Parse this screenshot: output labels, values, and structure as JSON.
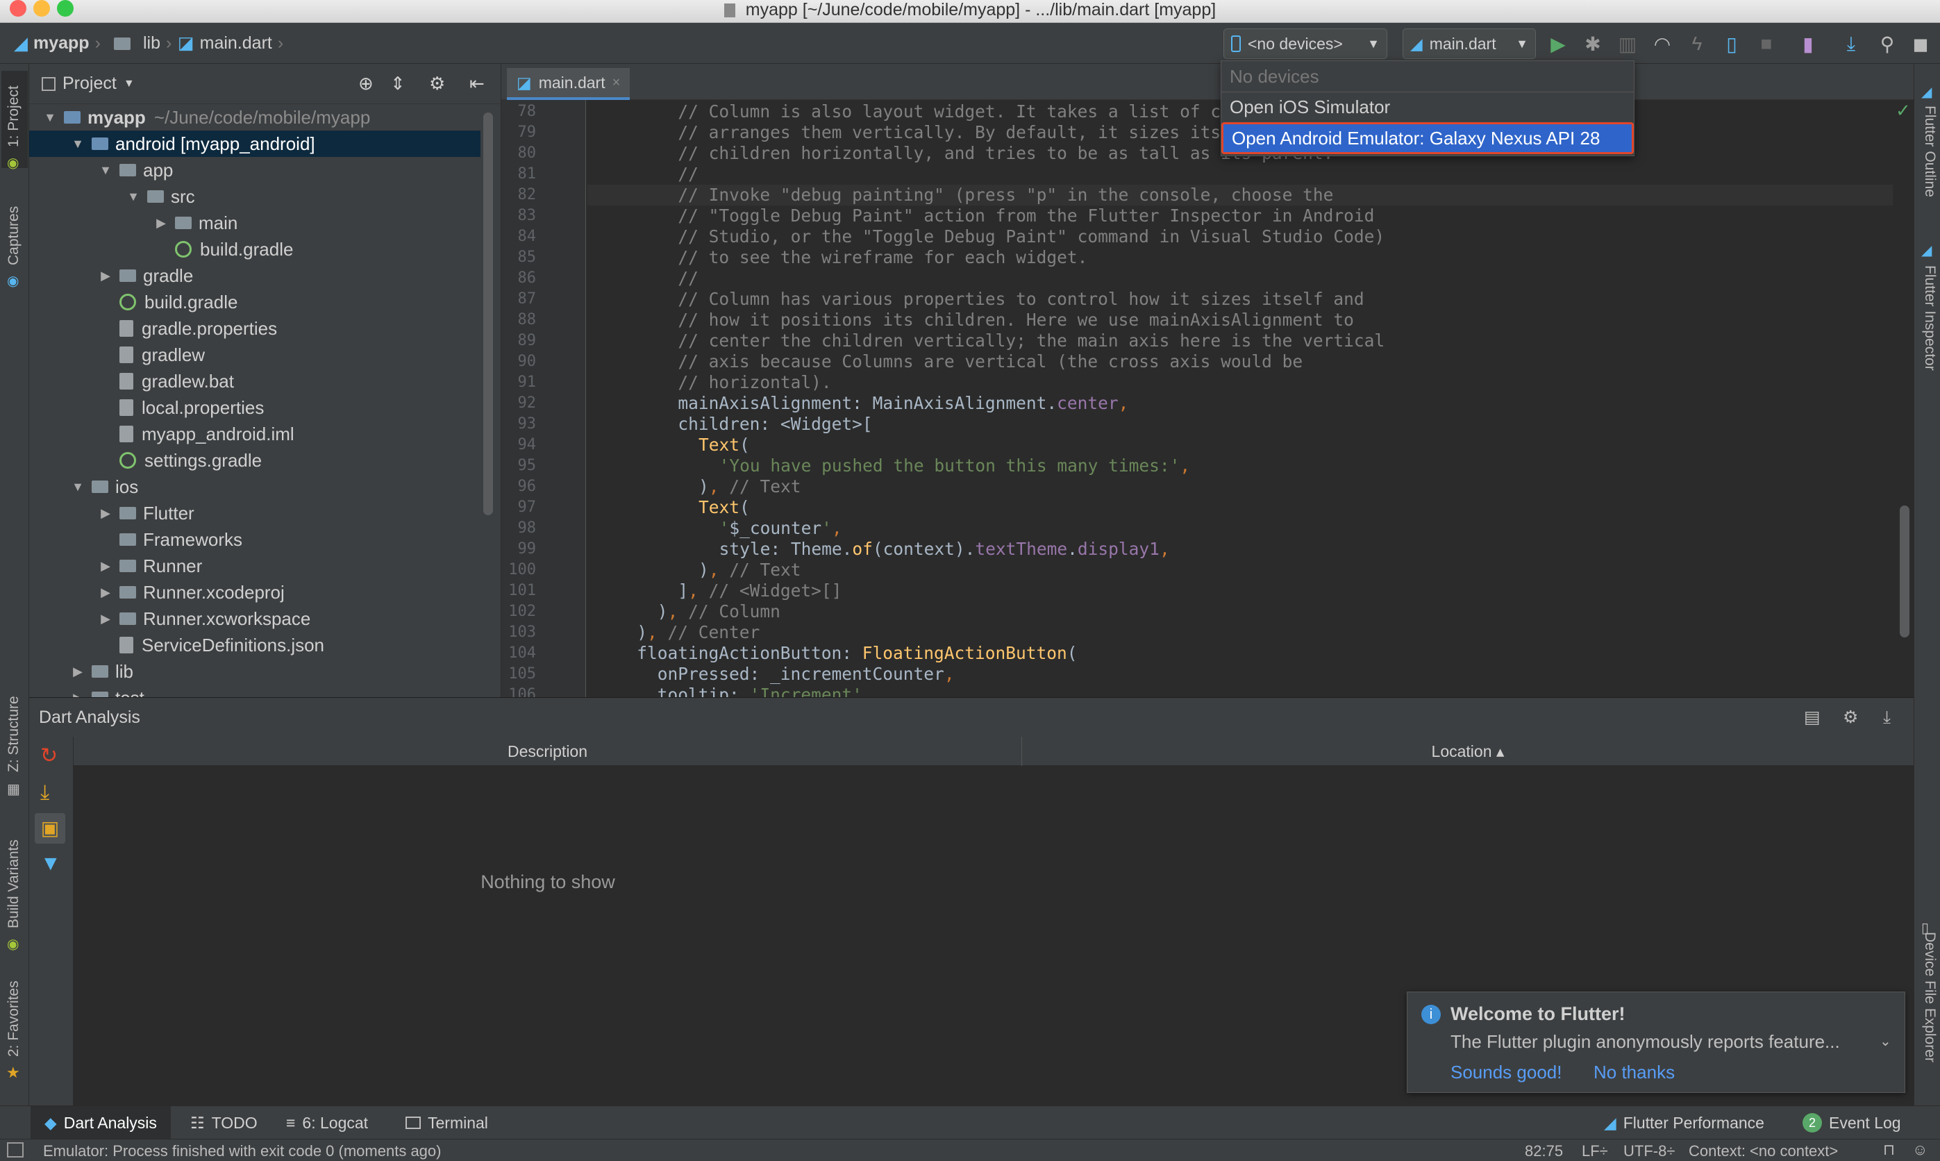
{
  "window": {
    "title": "myapp [~/June/code/mobile/myapp] - .../lib/main.dart [myapp]"
  },
  "breadcrumb": {
    "project": "myapp",
    "folder": "lib",
    "file": "main.dart"
  },
  "toolbar": {
    "device_combo": "<no devices>",
    "run_config": "main.dart"
  },
  "device_menu": {
    "header": "No devices",
    "items": [
      "Open iOS Simulator",
      "Open Android Emulator: Galaxy Nexus API 28"
    ],
    "highlight_color": "#2f65ca",
    "outline_color": "#e0452b"
  },
  "left_tabs": [
    "1: Project",
    "Captures",
    "Z: Structure",
    "Build Variants",
    "2: Favorites"
  ],
  "right_tabs": [
    "Flutter Outline",
    "Flutter Inspector",
    "Device File Explorer"
  ],
  "project_panel": {
    "title": "Project",
    "tree": [
      {
        "label": "myapp",
        "suffix": "~/June/code/mobile/myapp",
        "depth": 0,
        "arrow": "▼",
        "icon": "folder-blue"
      },
      {
        "label": "android [myapp_android]",
        "depth": 1,
        "arrow": "▼",
        "icon": "folder-blue",
        "selected": true
      },
      {
        "label": "app",
        "depth": 2,
        "arrow": "▼",
        "icon": "folder"
      },
      {
        "label": "src",
        "depth": 3,
        "arrow": "▼",
        "icon": "folder"
      },
      {
        "label": "main",
        "depth": 4,
        "arrow": "▶",
        "icon": "folder"
      },
      {
        "label": "build.gradle",
        "depth": 4,
        "arrow": "",
        "icon": "gradle"
      },
      {
        "label": "gradle",
        "depth": 2,
        "arrow": "▶",
        "icon": "folder"
      },
      {
        "label": "build.gradle",
        "depth": 2,
        "arrow": "",
        "icon": "gradle"
      },
      {
        "label": "gradle.properties",
        "depth": 2,
        "arrow": "",
        "icon": "file"
      },
      {
        "label": "gradlew",
        "depth": 2,
        "arrow": "",
        "icon": "file"
      },
      {
        "label": "gradlew.bat",
        "depth": 2,
        "arrow": "",
        "icon": "file"
      },
      {
        "label": "local.properties",
        "depth": 2,
        "arrow": "",
        "icon": "file"
      },
      {
        "label": "myapp_android.iml",
        "depth": 2,
        "arrow": "",
        "icon": "file"
      },
      {
        "label": "settings.gradle",
        "depth": 2,
        "arrow": "",
        "icon": "gradle"
      },
      {
        "label": "ios",
        "depth": 1,
        "arrow": "▼",
        "icon": "folder"
      },
      {
        "label": "Flutter",
        "depth": 2,
        "arrow": "▶",
        "icon": "folder"
      },
      {
        "label": "Frameworks",
        "depth": 2,
        "arrow": "",
        "icon": "folder"
      },
      {
        "label": "Runner",
        "depth": 2,
        "arrow": "▶",
        "icon": "folder"
      },
      {
        "label": "Runner.xcodeproj",
        "depth": 2,
        "arrow": "▶",
        "icon": "folder"
      },
      {
        "label": "Runner.xcworkspace",
        "depth": 2,
        "arrow": "▶",
        "icon": "folder"
      },
      {
        "label": "ServiceDefinitions.json",
        "depth": 2,
        "arrow": "",
        "icon": "file"
      },
      {
        "label": "lib",
        "depth": 1,
        "arrow": "▶",
        "icon": "folder"
      },
      {
        "label": "test",
        "depth": 1,
        "arrow": "▶",
        "icon": "folder"
      }
    ]
  },
  "editor": {
    "tab": "main.dart",
    "lines": [
      {
        "n": "78",
        "indent": 8,
        "parts": [
          [
            "cm",
            "// Column is also layout widget. It takes a list of chi"
          ]
        ]
      },
      {
        "n": "79",
        "indent": 8,
        "parts": [
          [
            "cm",
            "// arranges them vertically. By default, it sizes itse"
          ]
        ]
      },
      {
        "n": "80",
        "indent": 8,
        "parts": [
          [
            "cm",
            "// children horizontally, and tries to be as tall as its parent."
          ]
        ]
      },
      {
        "n": "81",
        "indent": 8,
        "parts": [
          [
            "cm",
            "//"
          ]
        ]
      },
      {
        "n": "82",
        "indent": 8,
        "parts": [
          [
            "cm",
            "// Invoke \"debug painting\" (press \"p\" in the console, choose the"
          ]
        ]
      },
      {
        "n": "83",
        "indent": 8,
        "parts": [
          [
            "cm",
            "// \"Toggle Debug Paint\" action from the Flutter Inspector in Android"
          ]
        ]
      },
      {
        "n": "84",
        "indent": 8,
        "parts": [
          [
            "cm",
            "// Studio, or the \"Toggle Debug Paint\" command in Visual Studio Code)"
          ]
        ]
      },
      {
        "n": "85",
        "indent": 8,
        "parts": [
          [
            "cm",
            "// to see the wireframe for each widget."
          ]
        ]
      },
      {
        "n": "86",
        "indent": 8,
        "parts": [
          [
            "cm",
            "//"
          ]
        ]
      },
      {
        "n": "87",
        "indent": 8,
        "parts": [
          [
            "cm",
            "// Column has various properties to control how it sizes itself and"
          ]
        ]
      },
      {
        "n": "88",
        "indent": 8,
        "parts": [
          [
            "cm",
            "// how it positions its children. Here we use mainAxisAlignment to"
          ]
        ]
      },
      {
        "n": "89",
        "indent": 8,
        "parts": [
          [
            "cm",
            "// center the children vertically; the main axis here is the vertical"
          ]
        ]
      },
      {
        "n": "90",
        "indent": 8,
        "parts": [
          [
            "cm",
            "// axis because Columns are vertical (the cross axis would be"
          ]
        ]
      },
      {
        "n": "91",
        "indent": 8,
        "parts": [
          [
            "cm",
            "// horizontal)."
          ]
        ]
      },
      {
        "n": "92",
        "indent": 8,
        "parts": [
          [
            "tx",
            "mainAxisAlignment: MainAxisAlignment."
          ],
          [
            "pr",
            "center"
          ],
          [
            "kw",
            ","
          ]
        ]
      },
      {
        "n": "93",
        "indent": 8,
        "parts": [
          [
            "tx",
            "children: <Widget>["
          ]
        ]
      },
      {
        "n": "94",
        "indent": 10,
        "parts": [
          [
            "cl",
            "Text"
          ],
          [
            "tx",
            "("
          ]
        ]
      },
      {
        "n": "95",
        "indent": 12,
        "parts": [
          [
            "st",
            "'You have pushed the button this many times:'"
          ],
          [
            "kw",
            ","
          ]
        ]
      },
      {
        "n": "96",
        "indent": 10,
        "parts": [
          [
            "tx",
            ")"
          ],
          [
            "kw",
            ","
          ],
          [
            "cm",
            " // Text"
          ]
        ]
      },
      {
        "n": "97",
        "indent": 10,
        "parts": [
          [
            "cl",
            "Text"
          ],
          [
            "tx",
            "("
          ]
        ]
      },
      {
        "n": "98",
        "indent": 12,
        "parts": [
          [
            "st",
            "'"
          ],
          [
            "tx",
            "$_counter"
          ],
          [
            "st",
            "'"
          ],
          [
            "kw",
            ","
          ]
        ]
      },
      {
        "n": "99",
        "indent": 12,
        "parts": [
          [
            "tx",
            "style: Theme."
          ],
          [
            "cl",
            "of"
          ],
          [
            "tx",
            "(context)."
          ],
          [
            "pr",
            "textTheme"
          ],
          [
            "tx",
            "."
          ],
          [
            "pr",
            "display1"
          ],
          [
            "kw",
            ","
          ]
        ]
      },
      {
        "n": "100",
        "indent": 10,
        "parts": [
          [
            "tx",
            ")"
          ],
          [
            "kw",
            ","
          ],
          [
            "cm",
            " // Text"
          ]
        ]
      },
      {
        "n": "101",
        "indent": 8,
        "parts": [
          [
            "tx",
            "]"
          ],
          [
            "kw",
            ","
          ],
          [
            "cm",
            " // <Widget>[]"
          ]
        ]
      },
      {
        "n": "102",
        "indent": 6,
        "parts": [
          [
            "tx",
            ")"
          ],
          [
            "kw",
            ","
          ],
          [
            "cm",
            " // Column"
          ]
        ]
      },
      {
        "n": "103",
        "indent": 4,
        "parts": [
          [
            "tx",
            ")"
          ],
          [
            "kw",
            ","
          ],
          [
            "cm",
            " // Center"
          ]
        ]
      },
      {
        "n": "104",
        "indent": 4,
        "parts": [
          [
            "tx",
            "floatingActionButton: "
          ],
          [
            "cl",
            "FloatingActionButton"
          ],
          [
            "tx",
            "("
          ]
        ]
      },
      {
        "n": "105",
        "indent": 6,
        "parts": [
          [
            "tx",
            "onPressed: _incrementCounter"
          ],
          [
            "kw",
            ","
          ]
        ]
      },
      {
        "n": "106",
        "indent": 6,
        "parts": [
          [
            "tx",
            "tooltip: "
          ],
          [
            "st",
            "'Increment'"
          ],
          [
            "kw",
            ","
          ]
        ]
      }
    ]
  },
  "analysis": {
    "title": "Dart Analysis",
    "col_description": "Description",
    "col_location": "Location ▴",
    "empty": "Nothing to show"
  },
  "notification": {
    "title": "Welcome to Flutter!",
    "body": "The Flutter plugin anonymously reports feature...",
    "accept": "Sounds good!",
    "decline": "No thanks"
  },
  "toolwindows": {
    "dart_analysis": "Dart Analysis",
    "todo": "TODO",
    "logcat": "6: Logcat",
    "terminal": "Terminal",
    "flutter_perf": "Flutter Performance",
    "event_log": "Event Log",
    "event_badge": "2"
  },
  "status": {
    "message": "Emulator: Process finished with exit code 0 (moments ago)",
    "position": "82:75",
    "line_sep": "LF÷",
    "encoding": "UTF-8÷",
    "context": "Context: <no context>"
  }
}
